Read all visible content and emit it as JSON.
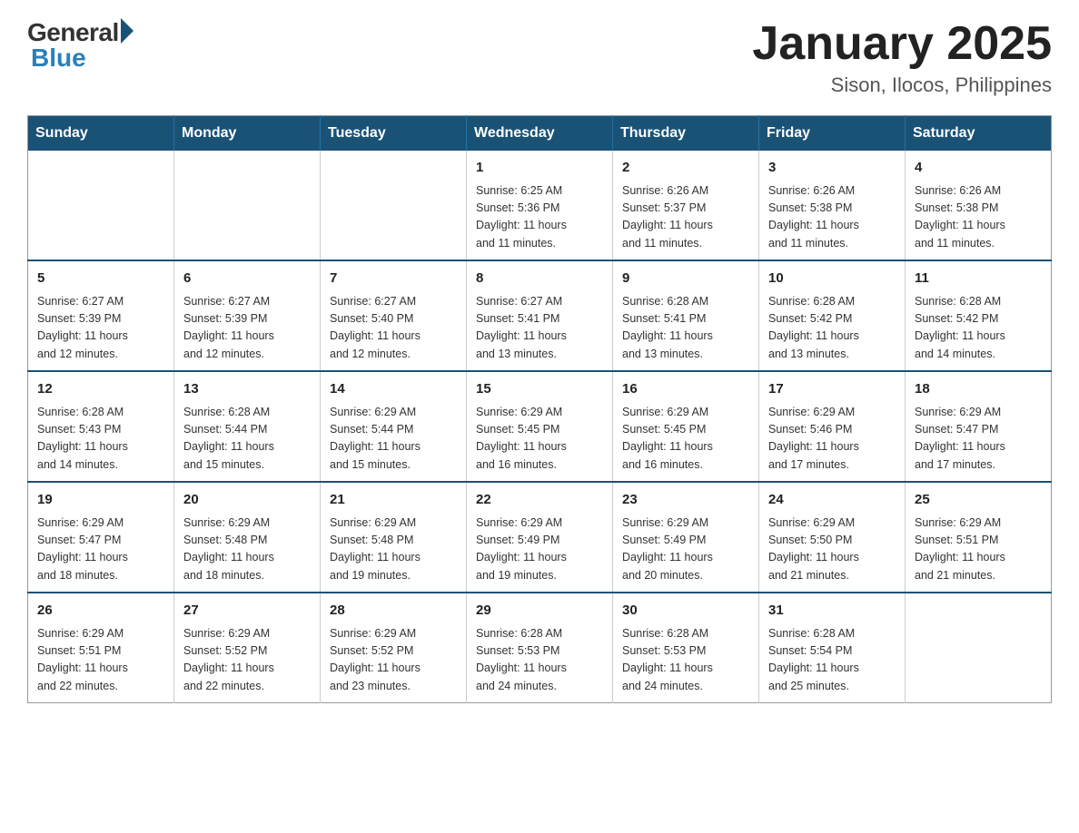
{
  "header": {
    "logo_general": "General",
    "logo_blue": "Blue",
    "month_title": "January 2025",
    "location": "Sison, Ilocos, Philippines"
  },
  "weekdays": [
    "Sunday",
    "Monday",
    "Tuesday",
    "Wednesday",
    "Thursday",
    "Friday",
    "Saturday"
  ],
  "weeks": [
    [
      {
        "day": "",
        "info": ""
      },
      {
        "day": "",
        "info": ""
      },
      {
        "day": "",
        "info": ""
      },
      {
        "day": "1",
        "info": "Sunrise: 6:25 AM\nSunset: 5:36 PM\nDaylight: 11 hours\nand 11 minutes."
      },
      {
        "day": "2",
        "info": "Sunrise: 6:26 AM\nSunset: 5:37 PM\nDaylight: 11 hours\nand 11 minutes."
      },
      {
        "day": "3",
        "info": "Sunrise: 6:26 AM\nSunset: 5:38 PM\nDaylight: 11 hours\nand 11 minutes."
      },
      {
        "day": "4",
        "info": "Sunrise: 6:26 AM\nSunset: 5:38 PM\nDaylight: 11 hours\nand 11 minutes."
      }
    ],
    [
      {
        "day": "5",
        "info": "Sunrise: 6:27 AM\nSunset: 5:39 PM\nDaylight: 11 hours\nand 12 minutes."
      },
      {
        "day": "6",
        "info": "Sunrise: 6:27 AM\nSunset: 5:39 PM\nDaylight: 11 hours\nand 12 minutes."
      },
      {
        "day": "7",
        "info": "Sunrise: 6:27 AM\nSunset: 5:40 PM\nDaylight: 11 hours\nand 12 minutes."
      },
      {
        "day": "8",
        "info": "Sunrise: 6:27 AM\nSunset: 5:41 PM\nDaylight: 11 hours\nand 13 minutes."
      },
      {
        "day": "9",
        "info": "Sunrise: 6:28 AM\nSunset: 5:41 PM\nDaylight: 11 hours\nand 13 minutes."
      },
      {
        "day": "10",
        "info": "Sunrise: 6:28 AM\nSunset: 5:42 PM\nDaylight: 11 hours\nand 13 minutes."
      },
      {
        "day": "11",
        "info": "Sunrise: 6:28 AM\nSunset: 5:42 PM\nDaylight: 11 hours\nand 14 minutes."
      }
    ],
    [
      {
        "day": "12",
        "info": "Sunrise: 6:28 AM\nSunset: 5:43 PM\nDaylight: 11 hours\nand 14 minutes."
      },
      {
        "day": "13",
        "info": "Sunrise: 6:28 AM\nSunset: 5:44 PM\nDaylight: 11 hours\nand 15 minutes."
      },
      {
        "day": "14",
        "info": "Sunrise: 6:29 AM\nSunset: 5:44 PM\nDaylight: 11 hours\nand 15 minutes."
      },
      {
        "day": "15",
        "info": "Sunrise: 6:29 AM\nSunset: 5:45 PM\nDaylight: 11 hours\nand 16 minutes."
      },
      {
        "day": "16",
        "info": "Sunrise: 6:29 AM\nSunset: 5:45 PM\nDaylight: 11 hours\nand 16 minutes."
      },
      {
        "day": "17",
        "info": "Sunrise: 6:29 AM\nSunset: 5:46 PM\nDaylight: 11 hours\nand 17 minutes."
      },
      {
        "day": "18",
        "info": "Sunrise: 6:29 AM\nSunset: 5:47 PM\nDaylight: 11 hours\nand 17 minutes."
      }
    ],
    [
      {
        "day": "19",
        "info": "Sunrise: 6:29 AM\nSunset: 5:47 PM\nDaylight: 11 hours\nand 18 minutes."
      },
      {
        "day": "20",
        "info": "Sunrise: 6:29 AM\nSunset: 5:48 PM\nDaylight: 11 hours\nand 18 minutes."
      },
      {
        "day": "21",
        "info": "Sunrise: 6:29 AM\nSunset: 5:48 PM\nDaylight: 11 hours\nand 19 minutes."
      },
      {
        "day": "22",
        "info": "Sunrise: 6:29 AM\nSunset: 5:49 PM\nDaylight: 11 hours\nand 19 minutes."
      },
      {
        "day": "23",
        "info": "Sunrise: 6:29 AM\nSunset: 5:49 PM\nDaylight: 11 hours\nand 20 minutes."
      },
      {
        "day": "24",
        "info": "Sunrise: 6:29 AM\nSunset: 5:50 PM\nDaylight: 11 hours\nand 21 minutes."
      },
      {
        "day": "25",
        "info": "Sunrise: 6:29 AM\nSunset: 5:51 PM\nDaylight: 11 hours\nand 21 minutes."
      }
    ],
    [
      {
        "day": "26",
        "info": "Sunrise: 6:29 AM\nSunset: 5:51 PM\nDaylight: 11 hours\nand 22 minutes."
      },
      {
        "day": "27",
        "info": "Sunrise: 6:29 AM\nSunset: 5:52 PM\nDaylight: 11 hours\nand 22 minutes."
      },
      {
        "day": "28",
        "info": "Sunrise: 6:29 AM\nSunset: 5:52 PM\nDaylight: 11 hours\nand 23 minutes."
      },
      {
        "day": "29",
        "info": "Sunrise: 6:28 AM\nSunset: 5:53 PM\nDaylight: 11 hours\nand 24 minutes."
      },
      {
        "day": "30",
        "info": "Sunrise: 6:28 AM\nSunset: 5:53 PM\nDaylight: 11 hours\nand 24 minutes."
      },
      {
        "day": "31",
        "info": "Sunrise: 6:28 AM\nSunset: 5:54 PM\nDaylight: 11 hours\nand 25 minutes."
      },
      {
        "day": "",
        "info": ""
      }
    ]
  ]
}
